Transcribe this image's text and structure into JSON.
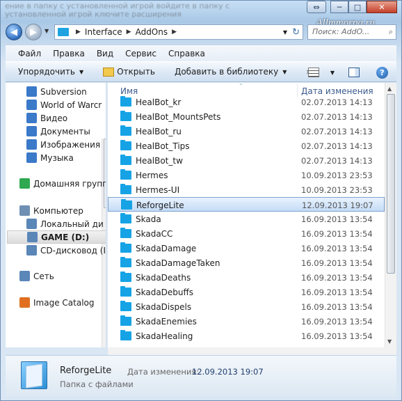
{
  "window": {
    "background_text": "ение в папку с установленной игрой\nвойдите в папку с установленной игрой\nключите расширения",
    "watermark": "Allmmorpg.ru",
    "controls": {
      "ext": "⇔",
      "minimize": "─",
      "maximize": "□",
      "close": "✕"
    }
  },
  "address": {
    "path": [
      "Interface",
      "AddOns"
    ],
    "search_placeholder": "Поиск: AddO..."
  },
  "menu": [
    "Файл",
    "Правка",
    "Вид",
    "Сервис",
    "Справка"
  ],
  "toolbar": {
    "organize": "Упорядочить",
    "open": "Открыть",
    "add_library": "Добавить в библиотеку",
    "more": "»"
  },
  "nav": [
    {
      "label": "Subversion",
      "icon": "subversion-icon",
      "color": "#3b79c9"
    },
    {
      "label": "World of Warcr",
      "icon": "document-icon",
      "color": "#3b79c9"
    },
    {
      "label": "Видео",
      "icon": "video-icon",
      "color": "#3b79c9"
    },
    {
      "label": "Документы",
      "icon": "documents-icon",
      "color": "#3b79c9"
    },
    {
      "label": "Изображения",
      "icon": "pictures-icon",
      "color": "#3b79c9"
    },
    {
      "label": "Музыка",
      "icon": "music-icon",
      "color": "#3b79c9"
    },
    {
      "label": "Домашняя групп",
      "icon": "homegroup-icon",
      "color": "#2fa84f"
    },
    {
      "label": "Компьютер",
      "icon": "computer-icon",
      "color": "#6f8fb3"
    },
    {
      "label": "Локальный ди",
      "icon": "local-disk-icon",
      "color": "#5a86b8"
    },
    {
      "label": "GAME (D:)",
      "icon": "drive-icon",
      "color": "#5a86b8"
    },
    {
      "label": "CD-дисковод (I",
      "icon": "cd-drive-icon",
      "color": "#5a86b8"
    },
    {
      "label": "Сеть",
      "icon": "network-icon",
      "color": "#5a86b8"
    },
    {
      "label": "Image Catalog",
      "icon": "image-catalog-icon",
      "color": "#e07020"
    }
  ],
  "columns": {
    "name": "Имя",
    "date": "Дата изменения"
  },
  "files": [
    {
      "name": "HealBot_kr",
      "date": "02.07.2013 14:13"
    },
    {
      "name": "HealBot_MountsPets",
      "date": "02.07.2013 14:13"
    },
    {
      "name": "HealBot_ru",
      "date": "02.07.2013 14:13"
    },
    {
      "name": "HealBot_Tips",
      "date": "02.07.2013 14:13"
    },
    {
      "name": "HealBot_tw",
      "date": "02.07.2013 14:13"
    },
    {
      "name": "Hermes",
      "date": "10.09.2013 23:53"
    },
    {
      "name": "Hermes-UI",
      "date": "10.09.2013 23:53"
    },
    {
      "name": "ReforgeLite",
      "date": "12.09.2013 19:07",
      "selected": true
    },
    {
      "name": "Skada",
      "date": "16.09.2013 13:54"
    },
    {
      "name": "SkadaCC",
      "date": "16.09.2013 13:54"
    },
    {
      "name": "SkadaDamage",
      "date": "16.09.2013 13:54"
    },
    {
      "name": "SkadaDamageTaken",
      "date": "16.09.2013 13:54"
    },
    {
      "name": "SkadaDeaths",
      "date": "16.09.2013 13:54"
    },
    {
      "name": "SkadaDebuffs",
      "date": "16.09.2013 13:54"
    },
    {
      "name": "SkadaDispels",
      "date": "16.09.2013 13:54"
    },
    {
      "name": "SkadaEnemies",
      "date": "16.09.2013 13:54"
    },
    {
      "name": "SkadaHealing",
      "date": "16.09.2013 13:54"
    }
  ],
  "details": {
    "name": "ReforgeLite",
    "date_label": "Дата изменения:",
    "date_value": "12.09.2013 19:07",
    "type": "Папка с файлами"
  }
}
